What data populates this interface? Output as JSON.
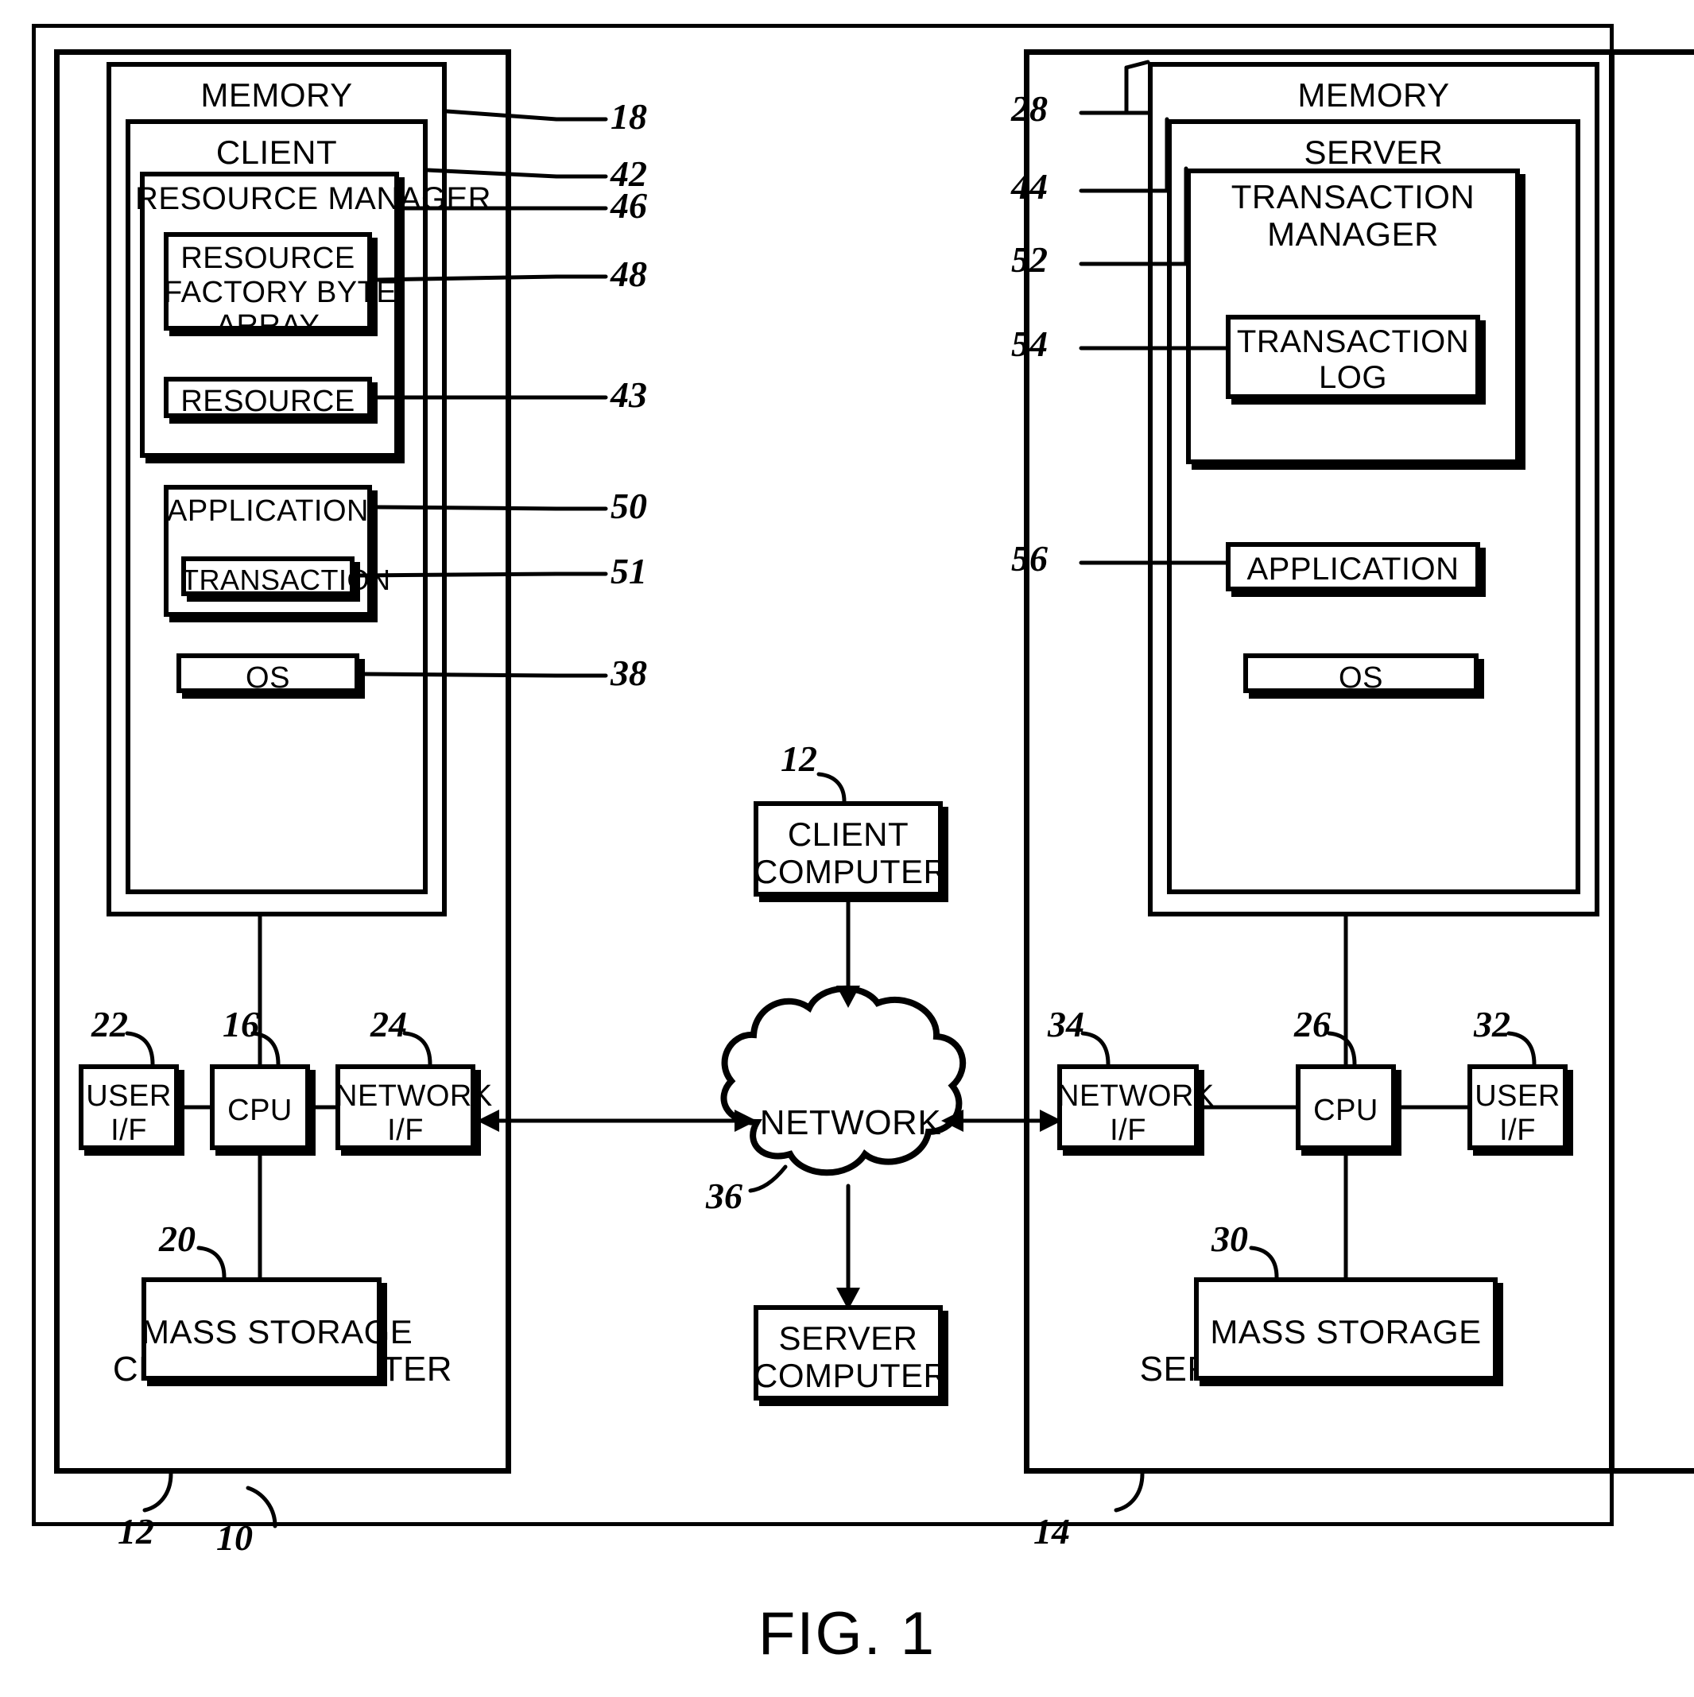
{
  "figure": {
    "caption": "FIG. 1",
    "system_ref": "10"
  },
  "client_computer": {
    "title": "CLIENT COMPUTER",
    "ref": "12",
    "memory": {
      "title": "MEMORY",
      "ref": "18",
      "client": {
        "title": "CLIENT",
        "ref": "42",
        "resource_manager": {
          "title": "RESOURCE MANAGER",
          "ref": "46",
          "resource_factory_byte_array": {
            "title": "RESOURCE\nFACTORY BYTE\nARRAY",
            "ref": "48"
          },
          "resource": {
            "title": "RESOURCE",
            "ref": "43"
          }
        },
        "application": {
          "title": "APPLICATION",
          "ref": "50",
          "transaction": {
            "title": "TRANSACTION",
            "ref": "51"
          }
        },
        "os": {
          "title": "OS",
          "ref": "38"
        }
      }
    },
    "user_if": {
      "title": "USER\nI/F",
      "ref": "22"
    },
    "cpu": {
      "title": "CPU",
      "ref": "16"
    },
    "network_if": {
      "title": "NETWORK\nI/F",
      "ref": "24"
    },
    "mass_storage": {
      "title": "MASS STORAGE",
      "ref": "20"
    }
  },
  "server_computer": {
    "title": "SERVER COMPUTER",
    "ref": "14",
    "memory": {
      "title": "MEMORY",
      "ref": "28",
      "server": {
        "title": "SERVER",
        "ref": "44",
        "transaction_manager": {
          "title": "TRANSACTION\nMANAGER",
          "ref": "52",
          "transaction_log": {
            "title": "TRANSACTION\nLOG",
            "ref": "54"
          }
        },
        "application": {
          "title": "APPLICATION",
          "ref": "56"
        },
        "os": {
          "title": "OS",
          "ref": null
        }
      }
    },
    "network_if": {
      "title": "NETWORK\nI/F",
      "ref": "34"
    },
    "cpu": {
      "title": "CPU",
      "ref": "26"
    },
    "user_if": {
      "title": "USER\nI/F",
      "ref": "32"
    },
    "mass_storage": {
      "title": "MASS STORAGE",
      "ref": "30"
    }
  },
  "middle": {
    "client_computer_node": {
      "title": "CLIENT\nCOMPUTER",
      "ref": "12"
    },
    "network_cloud": {
      "title": "NETWORK",
      "ref": "36"
    },
    "server_computer_node": {
      "title": "SERVER\nCOMPUTER",
      "ref": null
    }
  }
}
